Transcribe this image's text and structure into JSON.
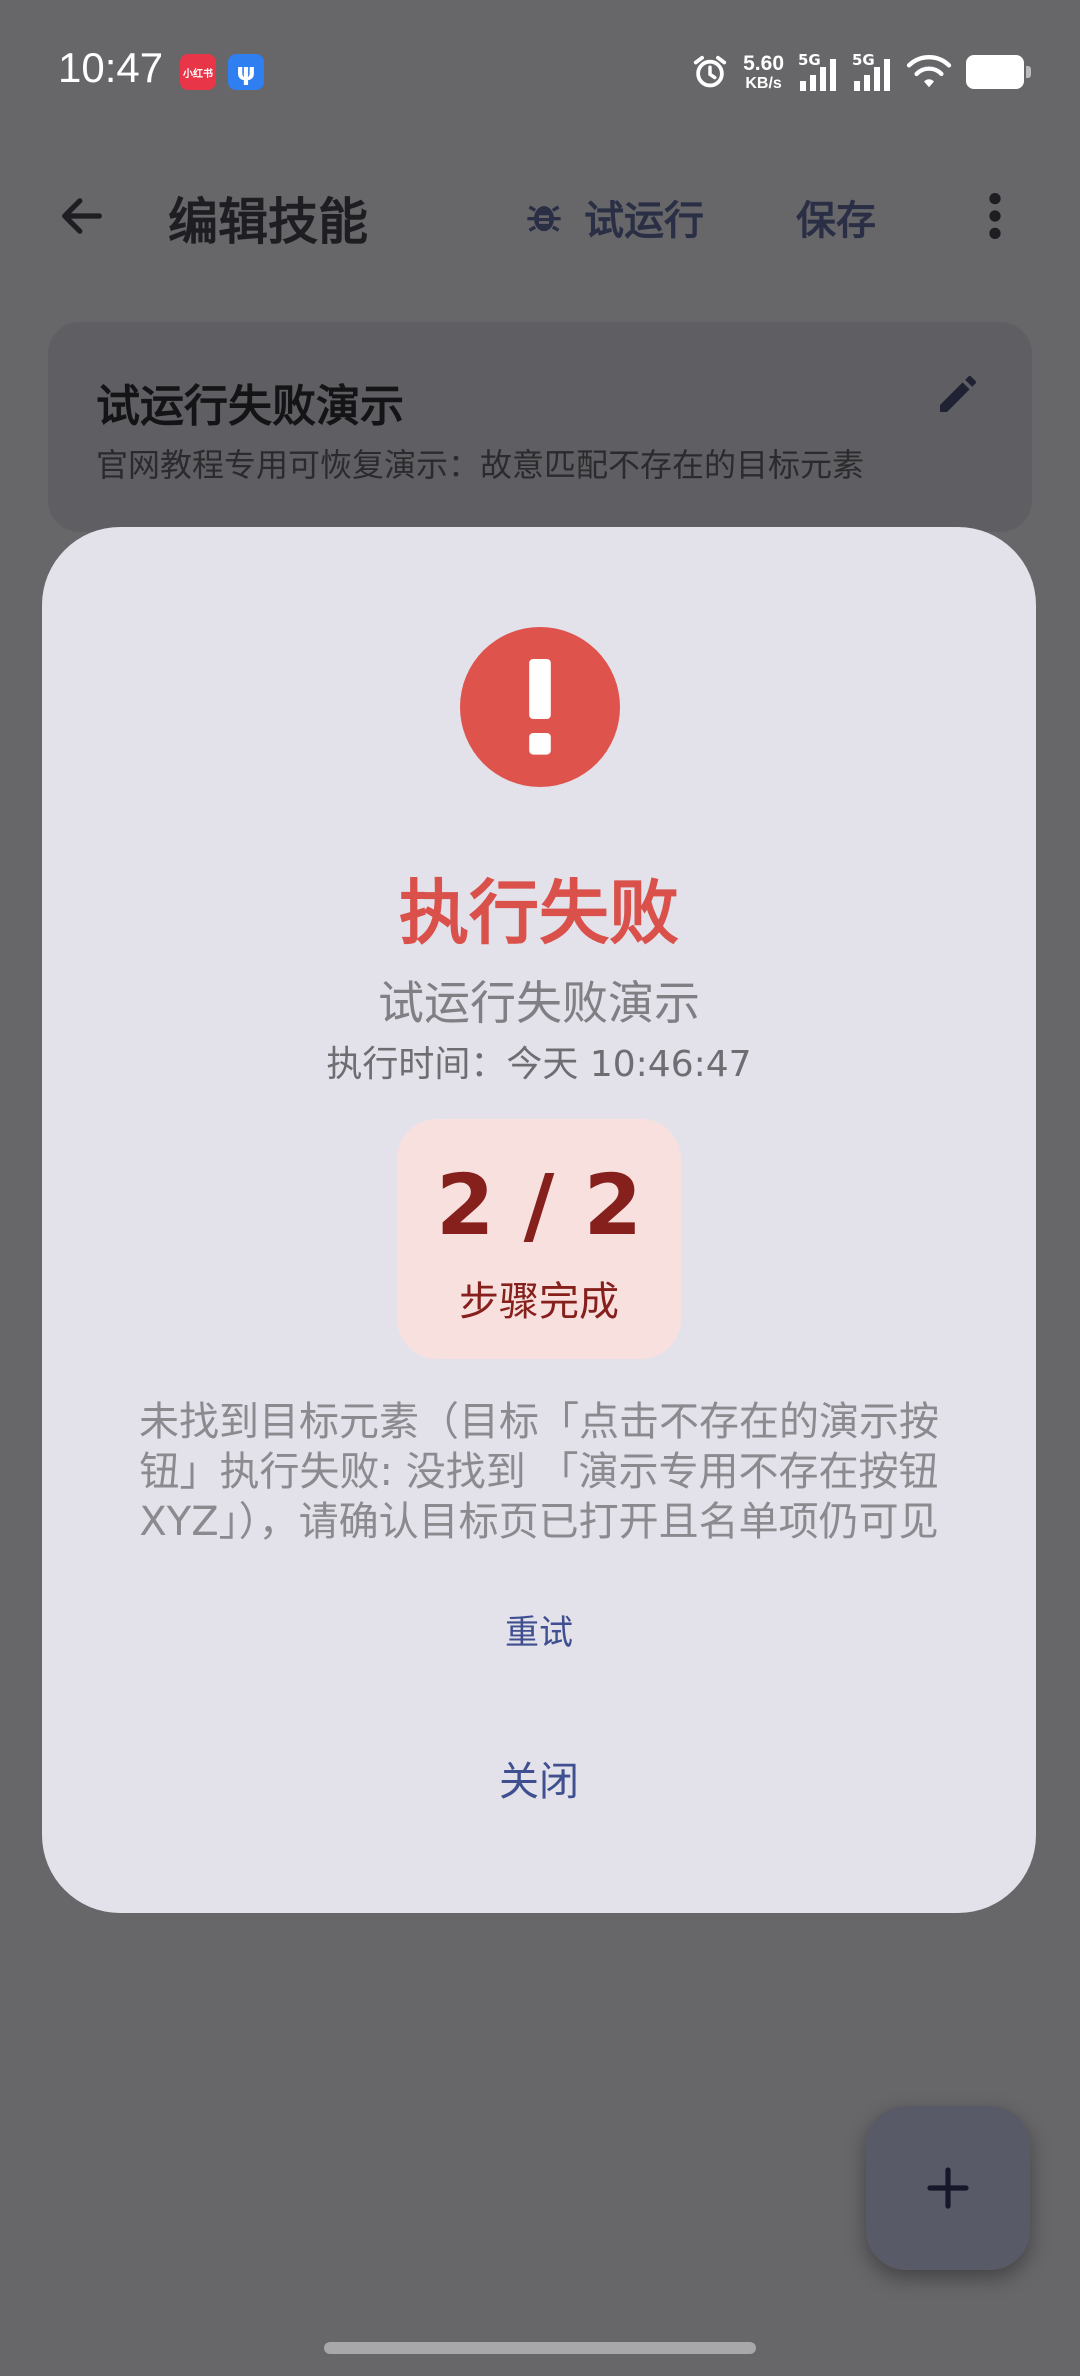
{
  "status_bar": {
    "time": "10:47",
    "net_speed_value": "5.60",
    "net_speed_unit": "KB/s",
    "signal_1_label": "5G",
    "signal_2_label": "5G",
    "badge_1_text": "小红书",
    "badge_2_text": "ψ"
  },
  "app_bar": {
    "title": "编辑技能",
    "trial_run_label": "试运行",
    "save_label": "保存"
  },
  "skill_card": {
    "name": "试运行失败演示",
    "description": "官网教程专用可恢复演示：故意匹配不存在的目标元素"
  },
  "dialog": {
    "title": "执行失败",
    "skill_name": "试运行失败演示",
    "exec_time": "执行时间：今天 10:46:47",
    "steps_value": "2 / 2",
    "steps_label": "步骤完成",
    "error_message": "未找到目标元素（目标「点击不存在的演示按钮」执行失败: 没找到 「演示专用不存在按钮XYZ」），请确认目标页已打开且名单项仍可见",
    "retry_label": "重试",
    "close_label": "关闭"
  },
  "colors": {
    "error": "#df534d",
    "accent": "#3f4f8f",
    "steps_bg": "#f8e0df",
    "steps_text": "#86201c"
  },
  "icons": [
    "back-arrow-icon",
    "bug-icon",
    "more-vert-icon",
    "edit-pencil-icon",
    "error-exclamation-icon",
    "plus-icon",
    "alarm-icon",
    "wifi-icon",
    "battery-icon"
  ]
}
